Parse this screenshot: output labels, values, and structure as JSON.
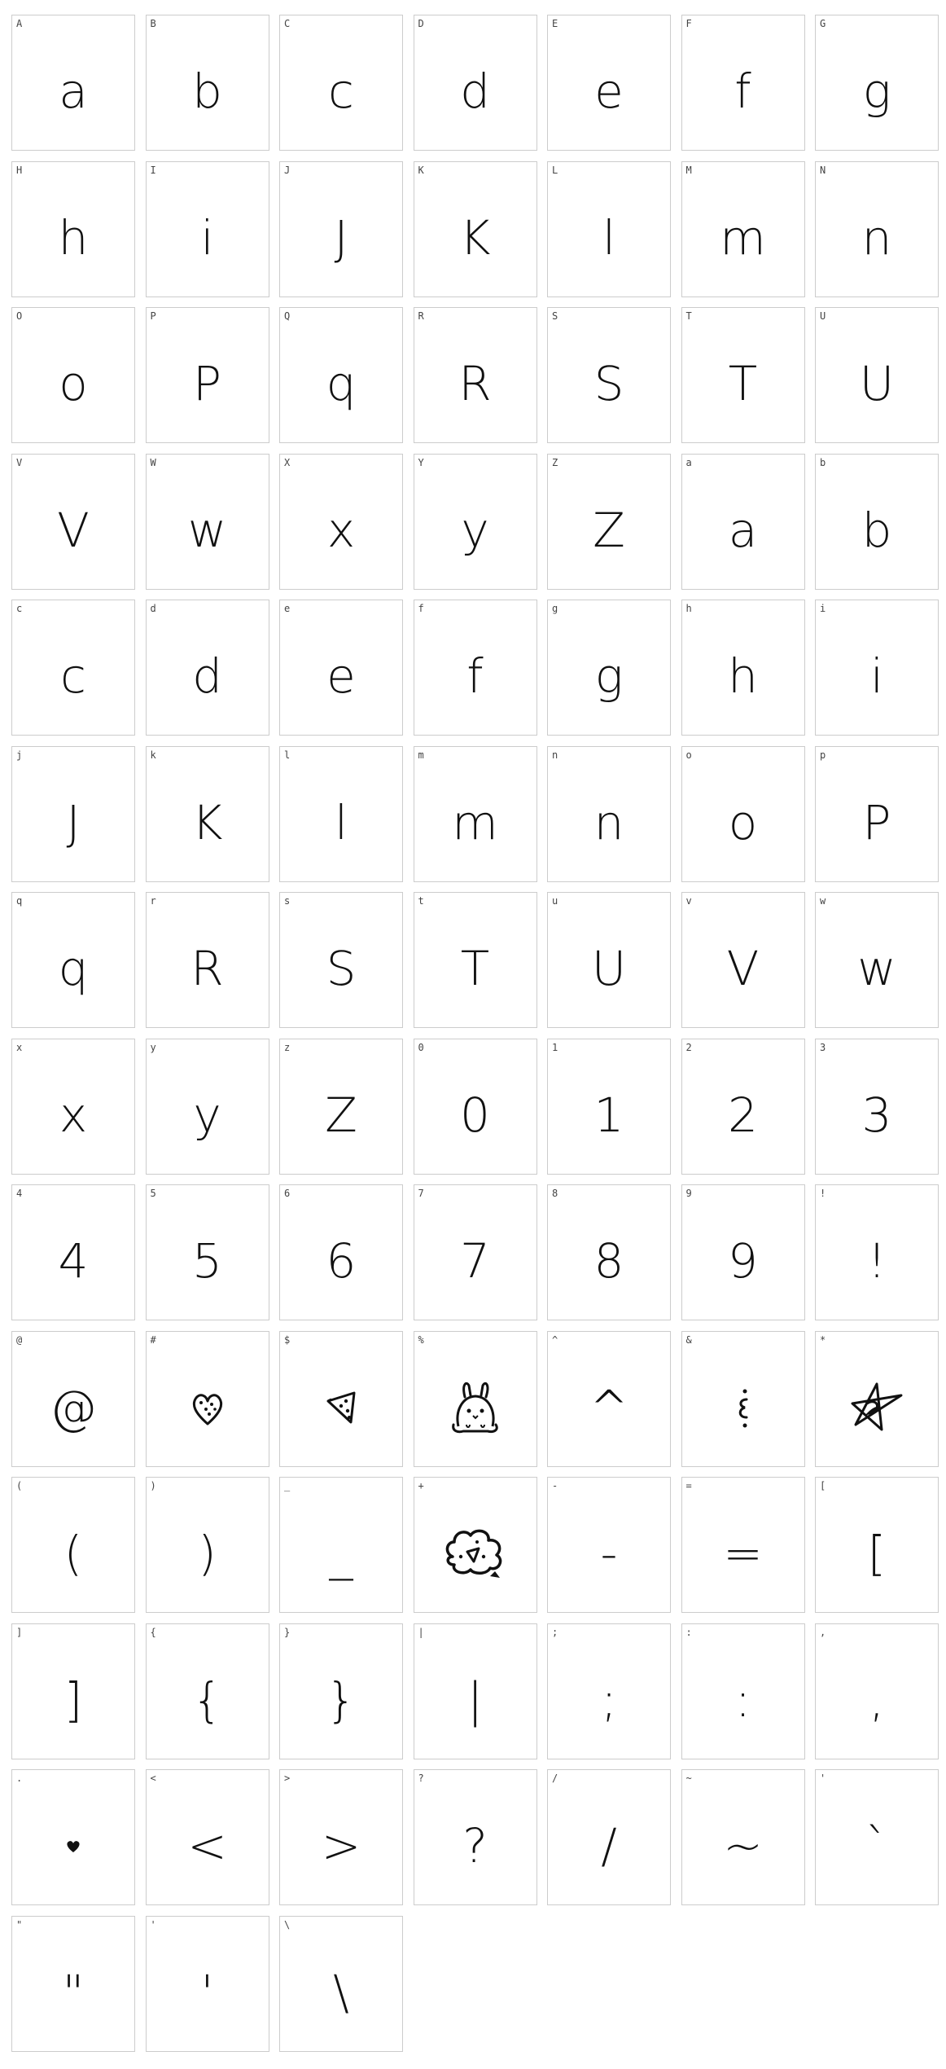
{
  "glyphs": [
    {
      "label": "A",
      "glyph": "a"
    },
    {
      "label": "B",
      "glyph": "b"
    },
    {
      "label": "C",
      "glyph": "c"
    },
    {
      "label": "D",
      "glyph": "d"
    },
    {
      "label": "E",
      "glyph": "e"
    },
    {
      "label": "F",
      "glyph": "f"
    },
    {
      "label": "G",
      "glyph": "g"
    },
    {
      "label": "H",
      "glyph": "h"
    },
    {
      "label": "I",
      "glyph": "i"
    },
    {
      "label": "J",
      "glyph": "J"
    },
    {
      "label": "K",
      "glyph": "K"
    },
    {
      "label": "L",
      "glyph": "l"
    },
    {
      "label": "M",
      "glyph": "m"
    },
    {
      "label": "N",
      "glyph": "n"
    },
    {
      "label": "O",
      "glyph": "o"
    },
    {
      "label": "P",
      "glyph": "P"
    },
    {
      "label": "Q",
      "glyph": "q"
    },
    {
      "label": "R",
      "glyph": "R"
    },
    {
      "label": "S",
      "glyph": "S"
    },
    {
      "label": "T",
      "glyph": "T"
    },
    {
      "label": "U",
      "glyph": "U"
    },
    {
      "label": "V",
      "glyph": "V"
    },
    {
      "label": "W",
      "glyph": "w"
    },
    {
      "label": "X",
      "glyph": "x"
    },
    {
      "label": "Y",
      "glyph": "y"
    },
    {
      "label": "Z",
      "glyph": "Z"
    },
    {
      "label": "a",
      "glyph": "a"
    },
    {
      "label": "b",
      "glyph": "b"
    },
    {
      "label": "c",
      "glyph": "c"
    },
    {
      "label": "d",
      "glyph": "d"
    },
    {
      "label": "e",
      "glyph": "e"
    },
    {
      "label": "f",
      "glyph": "f"
    },
    {
      "label": "g",
      "glyph": "g"
    },
    {
      "label": "h",
      "glyph": "h"
    },
    {
      "label": "i",
      "glyph": "i"
    },
    {
      "label": "j",
      "glyph": "J"
    },
    {
      "label": "k",
      "glyph": "K"
    },
    {
      "label": "l",
      "glyph": "l"
    },
    {
      "label": "m",
      "glyph": "m"
    },
    {
      "label": "n",
      "glyph": "n"
    },
    {
      "label": "o",
      "glyph": "o"
    },
    {
      "label": "p",
      "glyph": "P"
    },
    {
      "label": "q",
      "glyph": "q"
    },
    {
      "label": "r",
      "glyph": "R"
    },
    {
      "label": "s",
      "glyph": "S"
    },
    {
      "label": "t",
      "glyph": "T"
    },
    {
      "label": "u",
      "glyph": "U"
    },
    {
      "label": "v",
      "glyph": "V"
    },
    {
      "label": "w",
      "glyph": "w"
    },
    {
      "label": "x",
      "glyph": "x"
    },
    {
      "label": "y",
      "glyph": "y"
    },
    {
      "label": "z",
      "glyph": "Z"
    },
    {
      "label": "0",
      "glyph": "0"
    },
    {
      "label": "1",
      "glyph": "1"
    },
    {
      "label": "2",
      "glyph": "2"
    },
    {
      "label": "3",
      "glyph": "3"
    },
    {
      "label": "4",
      "glyph": "4"
    },
    {
      "label": "5",
      "glyph": "5"
    },
    {
      "label": "6",
      "glyph": "6"
    },
    {
      "label": "7",
      "glyph": "7"
    },
    {
      "label": "8",
      "glyph": "8"
    },
    {
      "label": "9",
      "glyph": "9"
    },
    {
      "label": "!",
      "glyph": "!"
    },
    {
      "label": "@",
      "glyph": "@"
    },
    {
      "label": "#",
      "glyph": "",
      "icon": "heart-icon"
    },
    {
      "label": "$",
      "glyph": "",
      "icon": "pizza-slice-icon"
    },
    {
      "label": "%",
      "glyph": "",
      "icon": "bunny-icon"
    },
    {
      "label": "^",
      "glyph": "^"
    },
    {
      "label": "&",
      "glyph": "",
      "icon": "ampersand-doodle-icon"
    },
    {
      "label": "*",
      "glyph": "",
      "icon": "star-scribble-icon"
    },
    {
      "label": "(",
      "glyph": "("
    },
    {
      "label": ")",
      "glyph": ")"
    },
    {
      "label": "_",
      "glyph": "_"
    },
    {
      "label": "+",
      "glyph": "",
      "icon": "cloud-heart-icon"
    },
    {
      "label": "-",
      "glyph": "-"
    },
    {
      "label": "=",
      "glyph": "="
    },
    {
      "label": "[",
      "glyph": "["
    },
    {
      "label": "]",
      "glyph": "]"
    },
    {
      "label": "{",
      "glyph": "{"
    },
    {
      "label": "}",
      "glyph": "}"
    },
    {
      "label": "|",
      "glyph": "|"
    },
    {
      "label": ";",
      "glyph": ";"
    },
    {
      "label": ":",
      "glyph": ":"
    },
    {
      "label": ",",
      "glyph": ","
    },
    {
      "label": ".",
      "glyph": "",
      "icon": "heart-dot-icon"
    },
    {
      "label": "<",
      "glyph": "<"
    },
    {
      "label": ">",
      "glyph": ">"
    },
    {
      "label": "?",
      "glyph": "?"
    },
    {
      "label": "/",
      "glyph": "/"
    },
    {
      "label": "~",
      "glyph": "~"
    },
    {
      "label": "'",
      "glyph": "`"
    },
    {
      "label": "\"",
      "glyph": "\""
    },
    {
      "label": "'",
      "glyph": "'"
    },
    {
      "label": "\\",
      "glyph": "\\"
    }
  ],
  "colors": {
    "ink": "#111111",
    "label": "#444444",
    "border": "#cccccc",
    "background": "#ffffff"
  }
}
